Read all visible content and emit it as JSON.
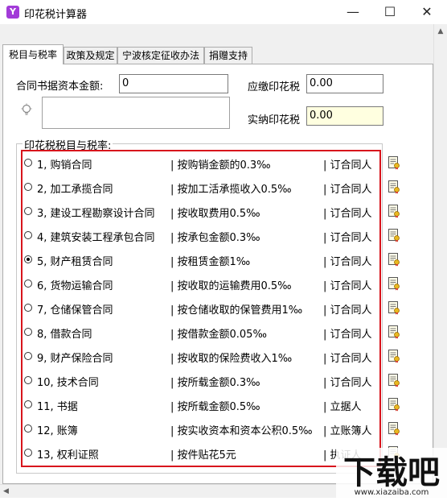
{
  "window": {
    "app_icon": "Y",
    "title": "印花税计算器",
    "min_glyph": "—",
    "max_glyph": "☐",
    "close_glyph": "✕"
  },
  "tabs": [
    {
      "label": "税目与税率"
    },
    {
      "label": "政策及规定"
    },
    {
      "label": "宁波核定征收办法"
    },
    {
      "label": "捐赠支持"
    }
  ],
  "form": {
    "capital_label": "合同书据资本金额:",
    "capital_value": "0",
    "payable_label": "应缴印花税",
    "payable_value": "0.00",
    "paid_label": "实纳印花税",
    "paid_value": "0.00"
  },
  "group_title": "印花税税目与税率:",
  "items": [
    {
      "name": "1, 购销合同",
      "basis": "| 按购销金额的0.3‰",
      "taxpayer": "| 订合同人",
      "selected": false
    },
    {
      "name": "2, 加工承揽合同",
      "basis": "| 按加工活承揽收入0.5‰",
      "taxpayer": "| 订合同人",
      "selected": false
    },
    {
      "name": "3, 建设工程勘察设计合同",
      "basis": "| 按收取费用0.5‰",
      "taxpayer": "| 订合同人",
      "selected": false
    },
    {
      "name": "4, 建筑安装工程承包合同",
      "basis": "| 按承包金额0.3‰",
      "taxpayer": "| 订合同人",
      "selected": false
    },
    {
      "name": "5, 财产租赁合同",
      "basis": "| 按租赁金额1‰",
      "taxpayer": "| 订合同人",
      "selected": true
    },
    {
      "name": "6, 货物运输合同",
      "basis": "| 按收取的运输费用0.5‰",
      "taxpayer": "| 订合同人",
      "selected": false
    },
    {
      "name": "7, 仓储保管合同",
      "basis": "| 按仓储收取的保管费用1‰",
      "taxpayer": "| 订合同人",
      "selected": false
    },
    {
      "name": "8, 借款合同",
      "basis": "| 按借款金额0.05‰",
      "taxpayer": "| 订合同人",
      "selected": false
    },
    {
      "name": "9, 财产保险合同",
      "basis": "| 按收取的保险费收入1‰",
      "taxpayer": "| 订合同人",
      "selected": false
    },
    {
      "name": "10, 技术合同",
      "basis": "| 按所载金额0.3‰",
      "taxpayer": "| 订合同人",
      "selected": false
    },
    {
      "name": "11, 书据",
      "basis": "| 按所载金额0.5‰",
      "taxpayer": "| 立据人",
      "selected": false
    },
    {
      "name": "12, 账簿",
      "basis": "| 按实收资本和资本公积0.5‰",
      "taxpayer": "| 立账簿人",
      "selected": false
    },
    {
      "name": "13, 权利证照",
      "basis": "| 按件贴花5元",
      "taxpayer": "| 执证人",
      "selected": false
    }
  ],
  "watermark": {
    "main": "下载吧",
    "url": "www.xiazaiba.com"
  }
}
